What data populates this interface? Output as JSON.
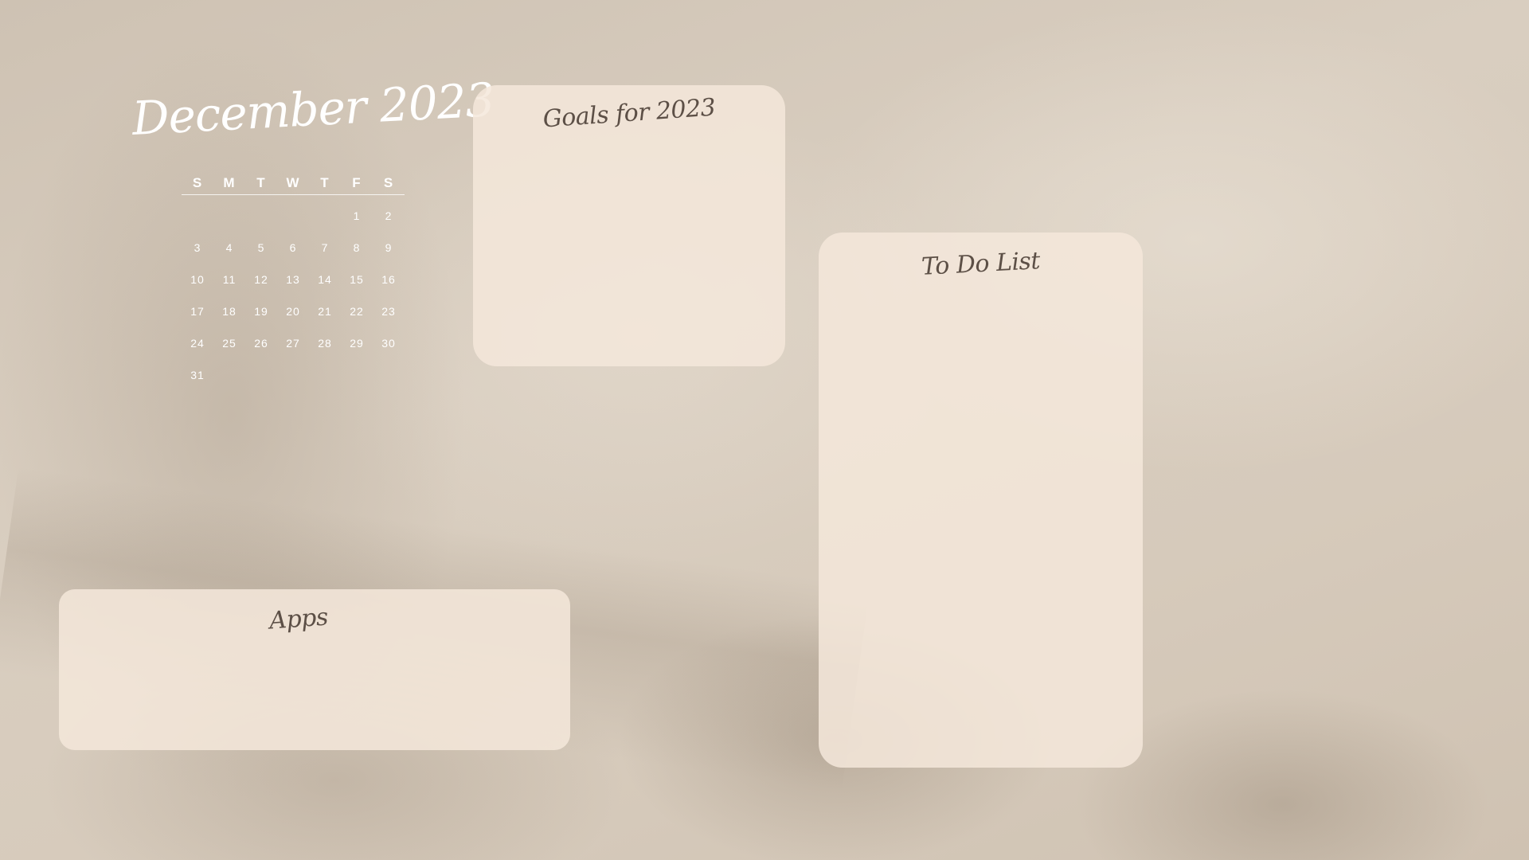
{
  "calendar": {
    "title": "December 2023",
    "weekdays": [
      "S",
      "M",
      "T",
      "W",
      "T",
      "F",
      "S"
    ],
    "weeks": [
      [
        "",
        "",
        "",
        "",
        "",
        "1",
        "2"
      ],
      [
        "3",
        "4",
        "5",
        "6",
        "7",
        "8",
        "9"
      ],
      [
        "10",
        "11",
        "12",
        "13",
        "14",
        "15",
        "16"
      ],
      [
        "17",
        "18",
        "19",
        "20",
        "21",
        "22",
        "23"
      ],
      [
        "24",
        "25",
        "26",
        "27",
        "28",
        "29",
        "30"
      ],
      [
        "31",
        "",
        "",
        "",
        "",
        "",
        ""
      ]
    ]
  },
  "goals": {
    "title": "Goals for 2023"
  },
  "todo": {
    "title": "To Do List"
  },
  "apps": {
    "title": "Apps"
  },
  "colors": {
    "card": "#f4e8db",
    "background": "#d8cdbf",
    "title_text": "#5c4f46",
    "calendar_text": "#ffffff"
  }
}
